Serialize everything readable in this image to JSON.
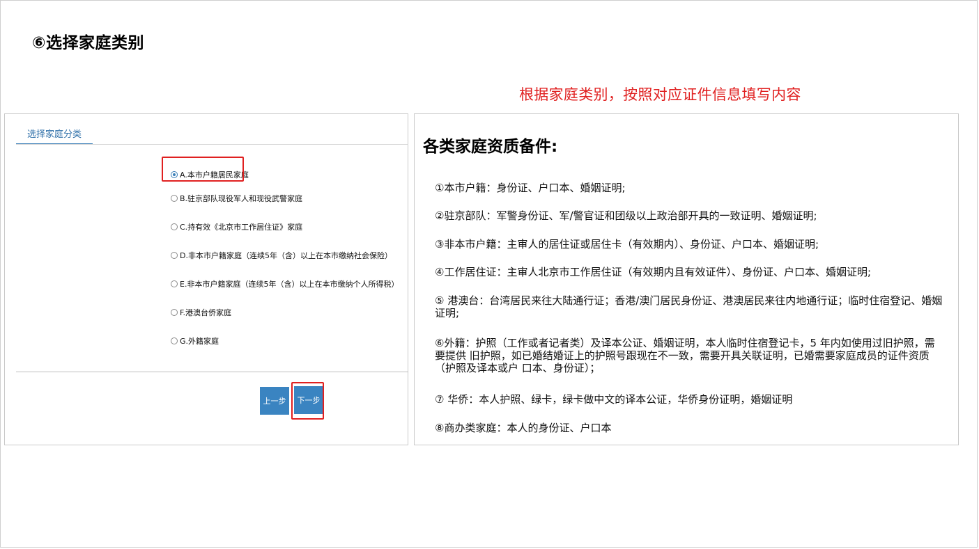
{
  "title": "⑥选择家庭类别",
  "note": "根据家庭类别，按照对应证件信息填写内容",
  "form": {
    "tab_label": "选择家庭分类",
    "options": [
      {
        "label": "A.本市户籍居民家庭",
        "selected": true
      },
      {
        "label": "B.驻京部队现役军人和现役武警家庭",
        "selected": false
      },
      {
        "label": "C.持有效《北京市工作居住证》家庭",
        "selected": false
      },
      {
        "label": "D.非本市户籍家庭（连续5年（含）以上在本市缴纳社会保险）",
        "selected": false
      },
      {
        "label": "E.非本市户籍家庭（连续5年（含）以上在本市缴纳个人所得税）",
        "selected": false
      },
      {
        "label": "F.港澳台侨家庭",
        "selected": false
      },
      {
        "label": "G.外籍家庭",
        "selected": false
      }
    ],
    "prev_label": "上一步",
    "next_label": "下一步",
    "accent_color": "#3a84c1",
    "highlight_color": "#e02020"
  },
  "requirements": {
    "heading": "各类家庭资质备件:",
    "items": [
      "①本市户籍：身份证、户口本、婚姻证明;",
      "②驻京部队：军警身份证、军/警官证和团级以上政治部开具的一致证明、婚姻证明;",
      "③非本市户籍：主审人的居住证或居住卡（有效期内）、身份证、户口本、婚姻证明;",
      "④工作居住证：主审人北京市工作居住证（有效期内且有效证件）、身份证、户口本、婚姻证明;",
      "⑤ 港澳台：台湾居民来往大陆通行证；香港/澳门居民身份证、港澳居民来往内地通行证；临时住宿登记、婚姻证明;",
      "⑥外籍：护照（工作或者记者类）及译本公证、婚姻证明，本人临时住宿登记卡，5 年内如使用过旧护照，需要提供 旧护照，如已婚结婚证上的护照号跟现在不一致，需要开具关联证明，已婚需要家庭成员的证件资质（护照及译本或户 口本、身份证）；",
      "⑦ 华侨：本人护照、绿卡，绿卡做中文的译本公证，华侨身份证明，婚姻证明",
      "⑧商办类家庭：本人的身份证、户口本"
    ]
  }
}
